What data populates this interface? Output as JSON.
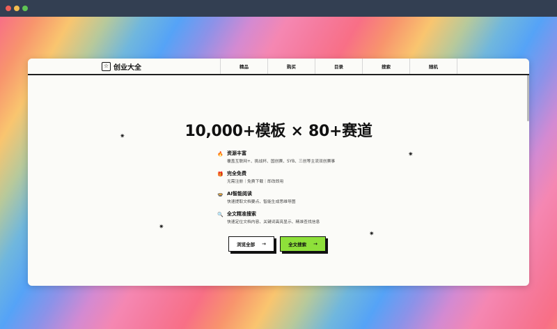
{
  "window_controls": [
    "close",
    "minimize",
    "maximize"
  ],
  "brand": {
    "name": "创业大全",
    "icon": "star-box-icon"
  },
  "nav": {
    "links": [
      "精品",
      "购买",
      "目录",
      "搜索",
      "随机"
    ]
  },
  "hero": {
    "title": "10,000+模板 × 80+赛道"
  },
  "features": [
    {
      "icon": "🔥",
      "title": "资源丰富",
      "desc": "覆盖互联网+、挑战杯、国创赛、SYB、三创等主流双创赛事"
    },
    {
      "icon": "🎁",
      "title": "完全免费",
      "desc": "无需注册｜免费下载｜即改即用"
    },
    {
      "icon": "🍲",
      "title": "AI智能阅读",
      "desc": "快速提取文档要点、智能生成思维导图"
    },
    {
      "icon": "🔍",
      "title": "全文精准搜索",
      "desc": "快速定位文档内容、关键词高亮显示、精准查找信息"
    }
  ],
  "buttons": {
    "browse": {
      "label": "浏览全部",
      "arrow": "→"
    },
    "search": {
      "label": "全文搜索",
      "arrow": "→"
    }
  },
  "colors": {
    "accent_green": "#8ee03a",
    "text_dark": "#111111",
    "page_bg": "#fbfbf8"
  }
}
